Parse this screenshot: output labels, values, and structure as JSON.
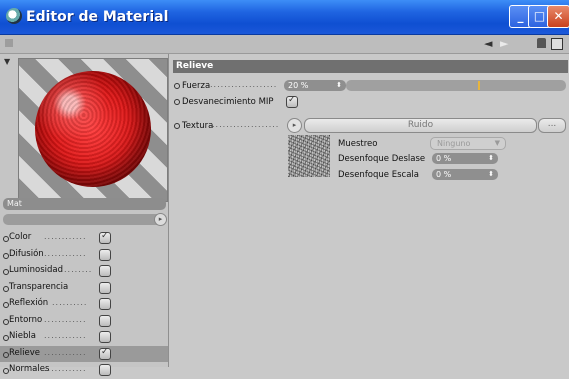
{
  "window": {
    "title": "Editor de Material",
    "minimize_glyph": "_",
    "maximize_glyph": "□",
    "close_glyph": "✕"
  },
  "toolbar": {
    "back_arrow": "◄",
    "forward_arrow": "►"
  },
  "preview": {
    "material_name": "Mat",
    "menu_arrow": "▸"
  },
  "channels": [
    {
      "label": "Color",
      "enabled": true,
      "active": false
    },
    {
      "label": "Difusión",
      "enabled": false,
      "active": false
    },
    {
      "label": "Luminosidad",
      "enabled": false,
      "active": false
    },
    {
      "label": "Transparencia",
      "enabled": false,
      "active": false
    },
    {
      "label": "Reflexión",
      "enabled": false,
      "active": false
    },
    {
      "label": "Entorno",
      "enabled": false,
      "active": false
    },
    {
      "label": "Niebla",
      "enabled": false,
      "active": false
    },
    {
      "label": "Relieve",
      "enabled": true,
      "active": true
    },
    {
      "label": "Normales",
      "enabled": false,
      "active": false
    }
  ],
  "panel": {
    "section_title": "Relieve",
    "fuerza": {
      "label": "Fuerza",
      "value": "20 %",
      "slider_fraction": 0.2
    },
    "mip": {
      "label": "Desvanecimiento MIP",
      "checked": true
    },
    "textura": {
      "label": "Textura",
      "shader_name": "Ruido",
      "more_button": "...",
      "arrow": "▸"
    },
    "muestreo": {
      "label": "Muestreo",
      "value": "Ninguno"
    },
    "desenfoque_deslase": {
      "label": "Desenfoque Deslase",
      "value": "0 %"
    },
    "desenfoque_escala": {
      "label": "Desenfoque Escala",
      "value": "0 %"
    }
  },
  "colors": {
    "titlebar": "#1f64e1",
    "section_header": "#707070",
    "slider_marker": "#e7b53d",
    "sphere_red": "#e11818"
  }
}
